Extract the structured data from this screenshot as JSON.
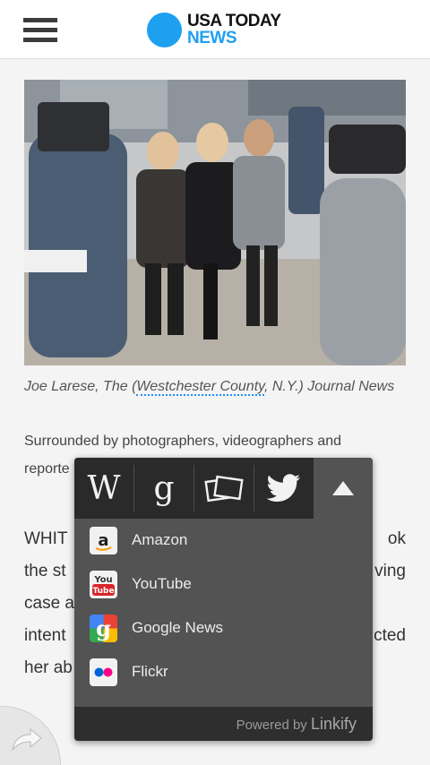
{
  "header": {
    "logo_line1": "USA TODAY",
    "logo_line2": "NEWS"
  },
  "article": {
    "photo_alt": "",
    "caption_pre": "Joe Larese, The (",
    "caption_link": "Westchester County",
    "caption_post": ", N.Y.) Journal News",
    "lead_line1": "Surrounded by photographers, videographers and",
    "lead_line2": "reporte",
    "body_lines": [
      {
        "left": "WHIT",
        "right": "ok"
      },
      {
        "left": "the st",
        "right": "ving"
      },
      {
        "left": "case a",
        "right": ""
      },
      {
        "left": "intent",
        "right": "cted"
      },
      {
        "left": "her ab",
        "right": ""
      }
    ]
  },
  "popup": {
    "tabs": [
      {
        "label": "W",
        "name": "wikipedia"
      },
      {
        "label": "g",
        "name": "google"
      },
      {
        "label": "",
        "name": "flickr-photos"
      },
      {
        "label": "",
        "name": "twitter"
      },
      {
        "label": "",
        "name": "collapse"
      }
    ],
    "items": [
      {
        "label": "Amazon",
        "icon": "amazon-icon"
      },
      {
        "label": "YouTube",
        "icon": "youtube-icon"
      },
      {
        "label": "Google News",
        "icon": "google-news-icon"
      },
      {
        "label": "Flickr",
        "icon": "flickr-icon"
      }
    ],
    "powered_prefix": "Powered by",
    "powered_brand": "Linkify"
  },
  "colors": {
    "brand_blue": "#1ea0f1",
    "popup_bg": "#535353",
    "tab_bg": "#2a2a2a"
  }
}
